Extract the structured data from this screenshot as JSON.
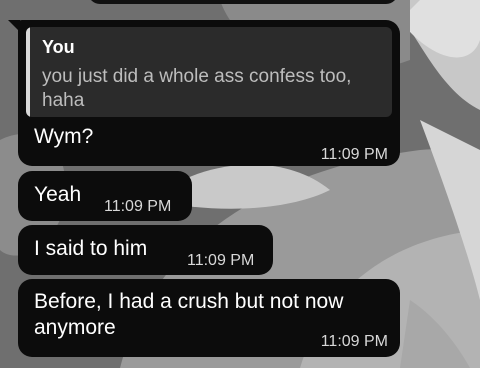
{
  "messages": [
    {
      "reply": {
        "author": "You",
        "text": "you just did a whole ass confess too, haha"
      },
      "text": "Wym?",
      "time": "11:09 PM"
    },
    {
      "text": "Yeah",
      "time": "11:09 PM"
    },
    {
      "text": "I said to him",
      "time": "11:09 PM"
    },
    {
      "text": "Before, I had a crush but not now anymore",
      "time": "11:09 PM"
    }
  ],
  "colors": {
    "bubble_bg": "#0c0c0c",
    "reply_bg": "#2b2b2b",
    "reply_bar": "#d9d9d9",
    "text": "#ffffff",
    "timestamp": "#d8d8d8"
  }
}
